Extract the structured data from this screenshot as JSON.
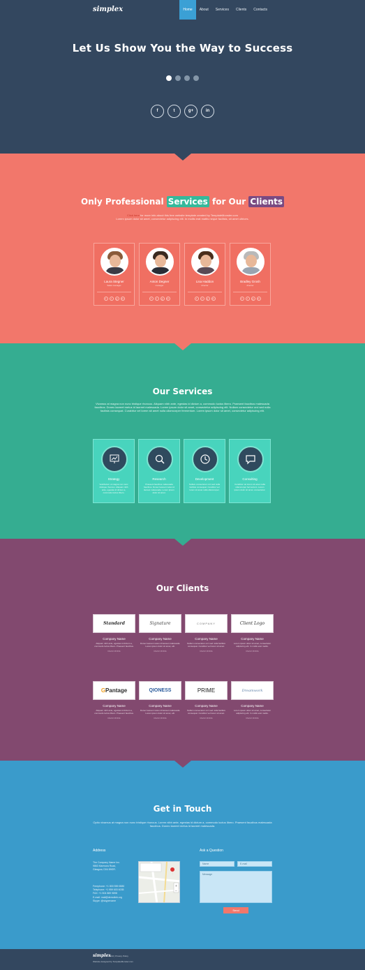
{
  "header": {
    "logo": "simplex",
    "menu": [
      "Home",
      "About",
      "Services",
      "Clients",
      "Contacts"
    ],
    "active_menu": "Home"
  },
  "hero": {
    "title": "Let Us Show You the Way to Success",
    "slides": 4,
    "active_slide": 1,
    "socials": [
      "f",
      "t",
      "g+",
      "in"
    ]
  },
  "team": {
    "title_part1": "Only Professional",
    "title_highlight1": "Services",
    "title_part2": "for Our",
    "title_highlight2": "Clients",
    "click_here": "Click here",
    "desc_line1": "for more info about this free website template created by TemplateMonster.com",
    "desc_line2": "Lorem ipsum dolor sit amet, consectetur adipiscing elit. In mollis erat mattis neque facilisis, sit amet ultrices.",
    "members": [
      {
        "name": "Laura Stegner",
        "role": "Sales manager"
      },
      {
        "name": "Anton Degner",
        "role": "manager"
      },
      {
        "name": "Lisa Haddon",
        "role": "director"
      },
      {
        "name": "Bradley Grosh",
        "role": "director"
      }
    ],
    "member_socials": [
      "f",
      "t",
      "g",
      "in"
    ]
  },
  "services": {
    "title": "Our Services",
    "desc": "Vivamus at magna non nunc tristique rhoncus. Aliquam nibh ante, egestas id dictum a, commodo luctus libero. Praesent faucibus malesuada faucibus. Donec laoreet metus id laoreet malesuada. Lorem ipsum dolor sit amet, consectetur adipiscing elit. Nullam consectetur orci sed nulla facilisis consequat. Curabitur vel lorem sit amet nulla ullamcorper fermentum. Lorem ipsum dolor sit amet, consectetur adipiscing elit.",
    "items": [
      {
        "name": "Strategy",
        "icon": "presentation-icon",
        "text": "Vestibulum ut magna non nunc tristique rhoncus. Aliquam nibh ante, egestas id dictum a, commodo luctus libero."
      },
      {
        "name": "Research",
        "icon": "magnifier-icon",
        "text": "Praesent faucibus malesuada faucibus. Donec laoreet metus id laoreet malesuada. Lorem ipsum dolor sit amet."
      },
      {
        "name": "Development",
        "icon": "clock-icon",
        "text": "Nullam consectetur orci sed nulla facilisis consequat. Curabitur vel lorem sit amet nulla ullamcorper."
      },
      {
        "name": "Consulting",
        "icon": "chat-icon",
        "text": "Curabitur vel lorem sit amet nulla ullamcorper fermentum. Lorem ipsum dolor sit amet, consectetur."
      }
    ]
  },
  "clients": {
    "title": "Our Clients",
    "row1": [
      {
        "logo": "Standard",
        "name": "Company Name",
        "desc": "Aliquam nibh ante, egestas id dictum a, commodo luctus libero. Praesent faucibus.",
        "more": "READ MORE"
      },
      {
        "logo": "Signature",
        "name": "Company Name",
        "desc": "Donec laoreet metus id laoreet malesuada. Lorem ipsum dolor sit amet, elit.",
        "more": "READ MORE"
      },
      {
        "logo": "COMPANY",
        "name": "Company Name",
        "desc": "Nullam consectetur orci sed nulla facilisis consequat. Curabitur vel lorem sit amet.",
        "more": "READ MORE"
      },
      {
        "logo": "Client Logo",
        "name": "Company Name",
        "desc": "Lorem ipsum dolor sit amet, consectetur adipiscing elit. In mollis erat mattis.",
        "more": "READ MORE"
      }
    ],
    "row2": [
      {
        "logo": "Pantage",
        "name": "Company Name",
        "desc": "Aliquam nibh ante, egestas id dictum a, commodo luctus libero. Praesent faucibus.",
        "more": "READ MORE"
      },
      {
        "logo": "QIONESS",
        "name": "Company Name",
        "desc": "Donec laoreet metus id laoreet malesuada. Lorem ipsum dolor sit amet, elit.",
        "more": "READ MORE"
      },
      {
        "logo": "PRIME",
        "name": "Company Name",
        "desc": "Nullam consectetur orci sed nulla facilisis consequat. Curabitur vel lorem sit amet.",
        "more": "READ MORE"
      },
      {
        "logo": "Dreamwork",
        "name": "Company Name",
        "desc": "Lorem ipsum dolor sit amet, consectetur adipiscing elit. In mollis erat mattis.",
        "more": "READ MORE"
      }
    ]
  },
  "contact": {
    "title": "Get in Touch",
    "desc": "Optio vivamus at magna non nunc tristique rhoncus. Lorem nibh ante, egestas id dictum a, commodo luctus libero. Praesent faucibus malesuada faucibus. Donec laoreet metus id laoreet malesuada.",
    "address_title": "Address",
    "address_lines": [
      "The Company Name Inc.",
      "9863 Marmora Road,",
      "Glasgow, D04 89GR."
    ],
    "phone_lines": [
      "Freephone:   +1 800 559 6580",
      "Telephone:   +1 959 603 6035",
      "FAX:            +1 504 889 9898",
      "E-mail:   mail@demolink.org",
      "Skype:   @skypename"
    ],
    "ask_title": "Ask a Question",
    "name_placeholder": "Name",
    "email_placeholder": "E-mail",
    "message_placeholder": "Message",
    "send_label": "Send"
  },
  "footer": {
    "logo": "simplex",
    "copyright": "© 2013 | Privacy Policy",
    "designed": "Website designed by TemplateMonster.com"
  }
}
